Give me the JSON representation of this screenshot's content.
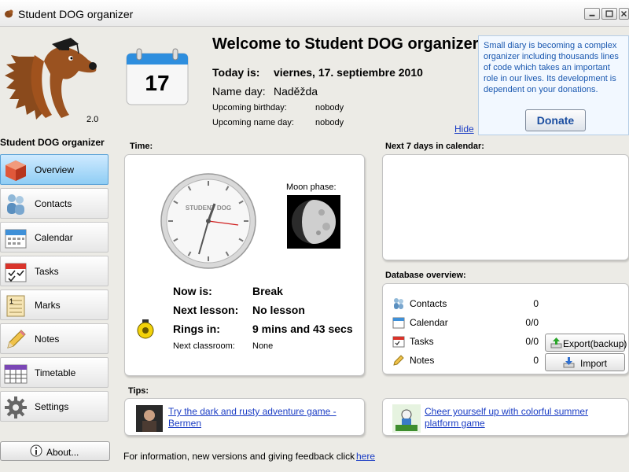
{
  "window": {
    "title": "Student DOG organizer"
  },
  "branding": {
    "version": "2.0",
    "app_name": "Student DOG organizer"
  },
  "sidebar": {
    "items": [
      {
        "label": "Overview",
        "icon": "cube-icon",
        "active": true
      },
      {
        "label": "Contacts",
        "icon": "people-icon",
        "active": false
      },
      {
        "label": "Calendar",
        "icon": "calendar-icon",
        "active": false
      },
      {
        "label": "Tasks",
        "icon": "tasks-icon",
        "active": false
      },
      {
        "label": "Marks",
        "icon": "marks-icon",
        "active": false
      },
      {
        "label": "Notes",
        "icon": "pencil-icon",
        "active": false
      },
      {
        "label": "Timetable",
        "icon": "timetable-icon",
        "active": false
      },
      {
        "label": "Settings",
        "icon": "gear-icon",
        "active": false
      }
    ],
    "about_label": "About..."
  },
  "header": {
    "calendar_day": "17",
    "welcome": "Welcome to Student DOG organizer!",
    "today_label": "Today is:",
    "today_value": "viernes, 17. septiembre 2010",
    "nameday_label": "Name day:",
    "nameday_value": "Naděžda",
    "upcoming_birthday_label": "Upcoming birthday:",
    "upcoming_birthday_value": "nobody",
    "upcoming_nameday_label": "Upcoming name day:",
    "upcoming_nameday_value": "nobody",
    "hide_label": "Hide"
  },
  "donate": {
    "text": "Small diary is becoming a complex organizer including thousands lines of code which takes an important role in our lives. Its development is dependent on your donations.",
    "button_label": "Donate"
  },
  "time_panel": {
    "section_label": "Time:",
    "clock_brand": "STUDENT DOG",
    "moon_label": "Moon phase:",
    "now_label": "Now is:",
    "now_value": "Break",
    "next_lesson_label": "Next lesson:",
    "next_lesson_value": "No lesson",
    "rings_label": "Rings in:",
    "rings_value": "9 mins and 43 secs",
    "next_classroom_label": "Next classroom:",
    "next_classroom_value": "None"
  },
  "calendar_panel": {
    "section_label": "Next 7 days in calendar:"
  },
  "database": {
    "section_label": "Database overview:",
    "rows": [
      {
        "label": "Contacts",
        "count": "0",
        "icon": "people-icon"
      },
      {
        "label": "Calendar",
        "count": "0/0",
        "icon": "calendar-icon"
      },
      {
        "label": "Tasks",
        "count": "0/0",
        "icon": "tasks-icon"
      },
      {
        "label": "Notes",
        "count": "0",
        "icon": "pencil-icon"
      }
    ],
    "export_label": "Export(backup)",
    "import_label": "Import"
  },
  "tips": {
    "section_label": "Tips:",
    "tip1": {
      "line1": "Try the dark and rusty adventure game -",
      "line2": "Bermen"
    },
    "tip2": {
      "line1": "Cheer yourself up with colorful summer",
      "line2": "platform game"
    }
  },
  "footer": {
    "text": "For information, new versions and giving feedback click",
    "link": "here"
  },
  "colors": {
    "accent": "#8fcdf4",
    "link": "#1a3cc4",
    "donate_text": "#1a58b0"
  }
}
